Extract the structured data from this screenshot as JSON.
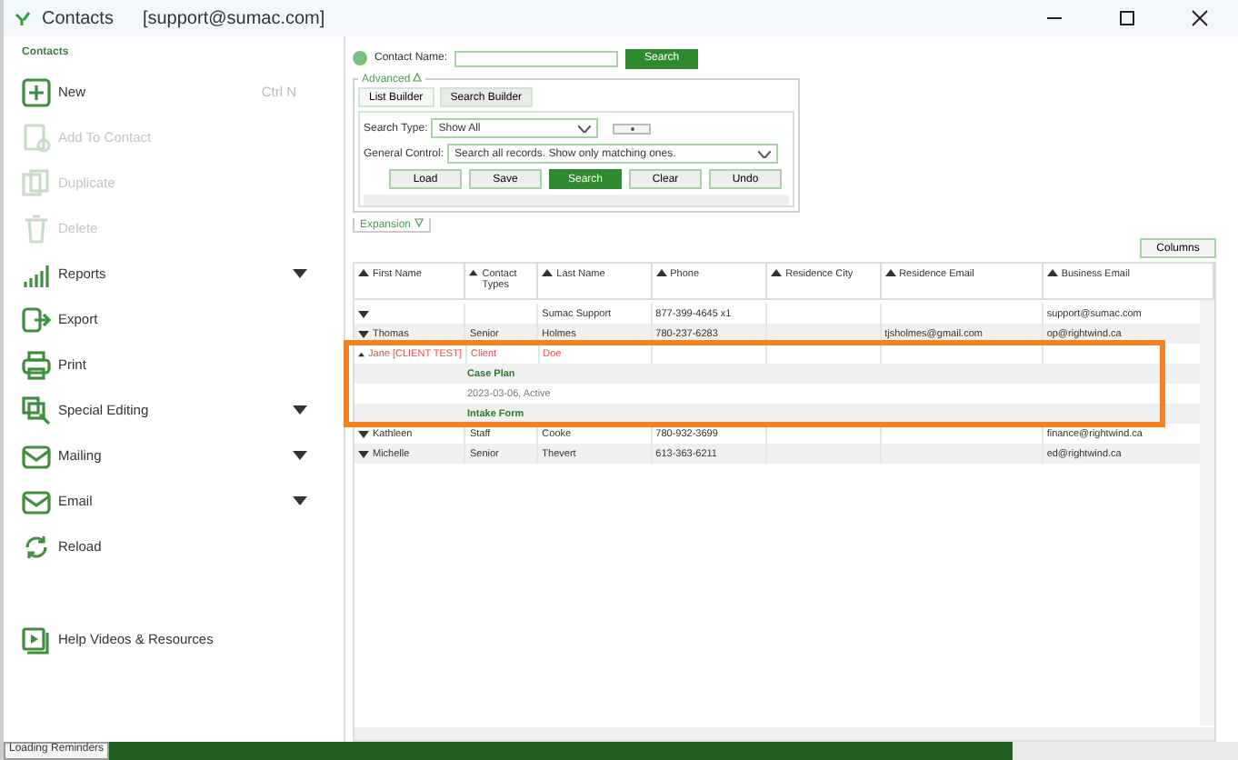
{
  "window": {
    "title": "Contacts",
    "account": "[support@sumac.com]"
  },
  "sidebar": {
    "heading": "Contacts",
    "items": [
      {
        "label": "New",
        "shortcut": "Ctrl N",
        "disabled": false,
        "expandable": false
      },
      {
        "label": "Add To Contact",
        "disabled": true,
        "expandable": false
      },
      {
        "label": "Duplicate",
        "disabled": true,
        "expandable": false
      },
      {
        "label": "Delete",
        "disabled": true,
        "expandable": false
      },
      {
        "label": "Reports",
        "disabled": false,
        "expandable": true
      },
      {
        "label": "Export",
        "disabled": false,
        "expandable": false
      },
      {
        "label": "Print",
        "disabled": false,
        "expandable": false
      },
      {
        "label": "Special Editing",
        "disabled": false,
        "expandable": true
      },
      {
        "label": "Mailing",
        "disabled": false,
        "expandable": true
      },
      {
        "label": "Email",
        "disabled": false,
        "expandable": true
      },
      {
        "label": "Reload",
        "disabled": false,
        "expandable": false
      }
    ],
    "footer_item": {
      "label": "Help Videos & Resources"
    }
  },
  "search": {
    "label": "Contact Name:",
    "button": "Search"
  },
  "advanced": {
    "legend": "Advanced",
    "tabs": [
      {
        "label": "List Builder",
        "selected": true
      },
      {
        "label": "Search Builder",
        "selected": false
      }
    ],
    "search_type": {
      "label": "Search Type:",
      "value": "Show All"
    },
    "general_control": {
      "label": "General Control:",
      "value": "Search all records. Show only matching ones."
    },
    "buttons": [
      {
        "label": "Load",
        "primary": false
      },
      {
        "label": "Save",
        "primary": false
      },
      {
        "label": "Search",
        "primary": true
      },
      {
        "label": "Clear",
        "primary": false
      },
      {
        "label": "Undo",
        "primary": false
      }
    ]
  },
  "expansion": {
    "label": "Expansion"
  },
  "columns_button": "Columns",
  "table": {
    "columns": [
      {
        "label": "First Name"
      },
      {
        "label": "Contact Types"
      },
      {
        "label": "Last Name"
      },
      {
        "label": "Phone"
      },
      {
        "label": "Residence City"
      },
      {
        "label": "Residence Email"
      },
      {
        "label": "Business Email"
      }
    ],
    "rows": [
      {
        "kind": "contact",
        "expanded": false,
        "flagged": false,
        "highlighted": false,
        "cells": [
          null,
          null,
          "Sumac Support",
          "877-399-4645 x1",
          null,
          null,
          "support@sumac.com"
        ]
      },
      {
        "kind": "contact",
        "expanded": false,
        "flagged": false,
        "highlighted": false,
        "cells": [
          "Thomas",
          "Senior",
          "Holmes",
          "780-237-6283",
          null,
          "tjsholmes@gmail.com",
          "op@rightwind.ca"
        ]
      },
      {
        "kind": "contact",
        "expanded": true,
        "flagged": true,
        "highlighted": true,
        "cells": [
          "Jane [CLIENT TEST]",
          "Client",
          "Doe"
        ]
      },
      {
        "kind": "section",
        "highlighted": true,
        "text": "Case Plan"
      },
      {
        "kind": "entry",
        "highlighted": true,
        "text": "2023-03-06, Active"
      },
      {
        "kind": "section",
        "highlighted": true,
        "text": "Intake Form"
      },
      {
        "kind": "contact",
        "expanded": false,
        "flagged": false,
        "highlighted": false,
        "cells": [
          "Kathleen",
          "Staff",
          "Cooke",
          "780-932-3699",
          null,
          null,
          "finance@rightwind.ca"
        ]
      },
      {
        "kind": "contact",
        "expanded": false,
        "flagged": false,
        "highlighted": false,
        "cells": [
          "Michelle",
          "Senior",
          "Thevert",
          "613-363-6211",
          null,
          null,
          "ed@rightwind.ca"
        ]
      }
    ]
  },
  "status_bar": {
    "text": "Loading Reminders",
    "level": 0.8
  }
}
